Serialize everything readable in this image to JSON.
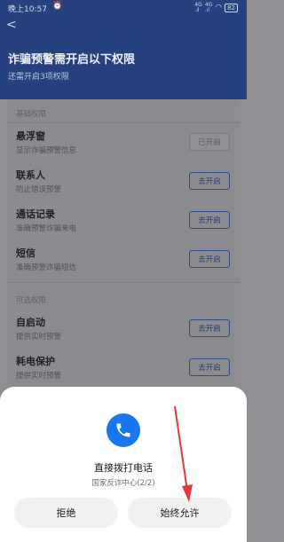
{
  "status_bar": {
    "time": "晚上10:57",
    "signal1": "4G\n.ill",
    "signal2": "4G\n.ill",
    "battery": "82"
  },
  "header": {
    "title": "诈骗预警需开启以下权限",
    "subtitle": "还需开启3项权限"
  },
  "basic": {
    "label": "基础权限",
    "items": [
      {
        "title": "悬浮窗",
        "desc": "显示诈骗预警信息",
        "button": "已开启"
      },
      {
        "title": "联系人",
        "desc": "防止错误预警",
        "button": "去开启"
      },
      {
        "title": "通话记录",
        "desc": "准确预警诈骗来电",
        "button": "去开启"
      },
      {
        "title": "短信",
        "desc": "准确预警诈骗短信",
        "button": "去开启"
      }
    ]
  },
  "optional": {
    "label": "可选权限",
    "items": [
      {
        "title": "自启动",
        "desc": "提供实时预警",
        "button": "去开启"
      },
      {
        "title": "耗电保护",
        "desc": "提供实时预警",
        "button": "去开启"
      }
    ]
  },
  "sheet": {
    "title": "直接拨打电话",
    "subtitle": "国家反诈中心(2/2)",
    "deny_label": "拒绝",
    "allow_label": "始终允许",
    "icon": "phone-icon"
  },
  "colors": {
    "accent": "#1677EE",
    "arrow": "#E53935"
  }
}
